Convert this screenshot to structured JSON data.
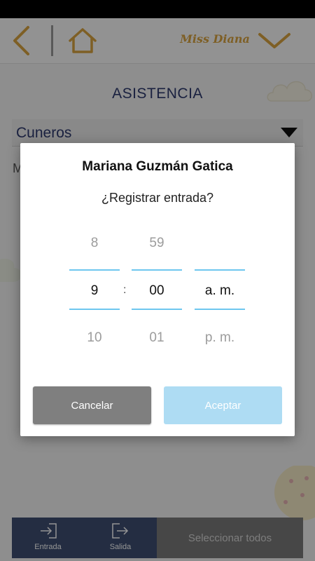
{
  "header": {
    "back_icon": "chevron-left-icon",
    "home_icon": "home-icon",
    "user_name": "Miss Diana",
    "menu_icon": "chevron-down-icon",
    "accent_color": "#d9a441"
  },
  "page": {
    "title": "ASISTENCIA",
    "group_selected": "Cuneros",
    "partial_text": "M"
  },
  "dialog": {
    "student_name": "Mariana Guzmán Gatica",
    "question": "¿Registrar entrada?",
    "picker": {
      "hour": {
        "prev": "8",
        "selected": "9",
        "next": "10"
      },
      "separator": ":",
      "minute": {
        "prev": "59",
        "selected": "00",
        "next": "01"
      },
      "period": {
        "prev": "",
        "selected": "a. m.",
        "next": "p. m."
      }
    },
    "cancel_label": "Cancelar",
    "accept_label": "Aceptar",
    "accent_color": "#6ec7ef"
  },
  "bottom_bar": {
    "entrada_label": "Entrada",
    "salida_label": "Salida",
    "select_all_label": "Seleccionar todos"
  }
}
